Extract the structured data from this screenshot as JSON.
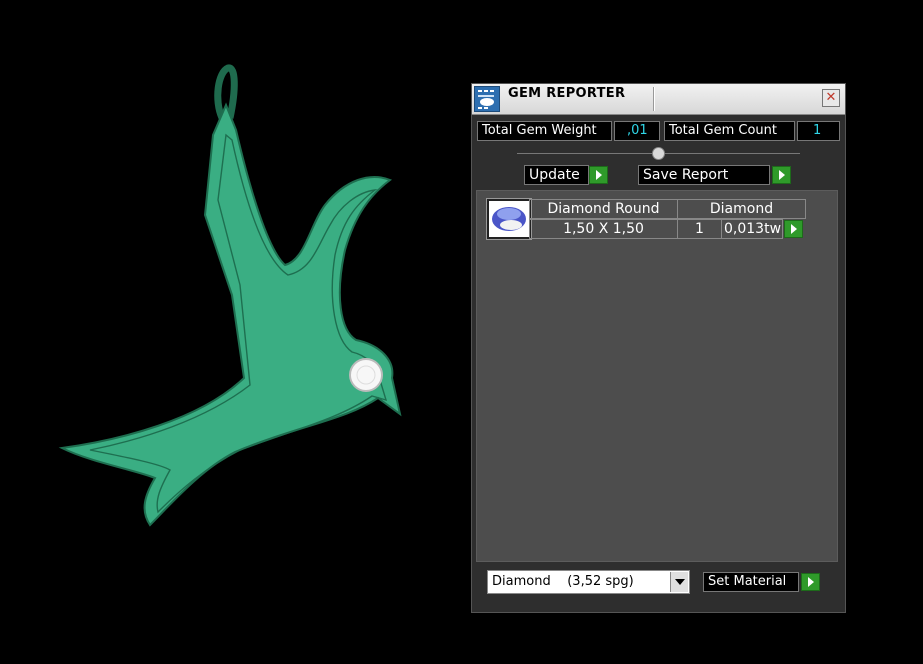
{
  "viewport": {
    "model": "bird-pendant"
  },
  "panel": {
    "title": "GEM REPORTER",
    "close_glyph": "✕",
    "total_weight_label": "Total Gem Weight",
    "total_weight_value": ",01",
    "total_count_label": "Total Gem Count",
    "total_count_value": "1",
    "update_label": "Update",
    "save_report_label": "Save Report"
  },
  "gems": [
    {
      "shape": "Diamond Round",
      "size": "1,50 X 1,50",
      "material": "Diamond",
      "count": "1",
      "weight": "0,013tw"
    }
  ],
  "bottom": {
    "material_select": "Diamond    (3,52 spg)",
    "set_material_label": "Set Material"
  },
  "colors": {
    "model_green": "#3aae83",
    "accent_green": "#2f9a2a",
    "value_cyan": "#2fd6e8"
  }
}
